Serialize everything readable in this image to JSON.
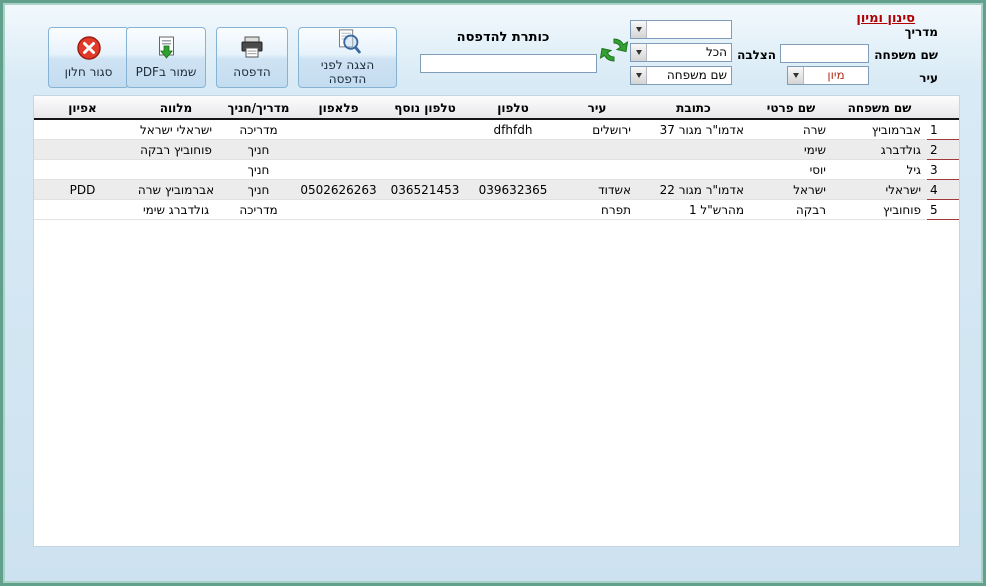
{
  "toolbar": {
    "close_label": "סגור חלון",
    "save_pdf_label": "שמור בPDF",
    "print_label": "הדפסה",
    "preview_label": "הצגה לפני הדפסה",
    "print_title_label": "כותרת להדפסה",
    "print_title_value": "",
    "icons": {
      "close": "red-circle-x",
      "save_pdf": "page-with-green-export-arrow",
      "print": "printer",
      "preview": "page-with-magnifier",
      "refresh": "green-circular-arrows"
    }
  },
  "filter_panel": {
    "title": "סינון ומיון",
    "instructor_label": "מדריך",
    "instructor_value": "",
    "crossing_label": "הצלבה",
    "crossing_value": "הכל",
    "last_name_label": "שם משפחה",
    "last_name_value": "",
    "city_label": "עיר",
    "sort_value": "מיון",
    "sort_by_value": "שם משפחה"
  },
  "colors": {
    "frame_teal": "#62a08e",
    "accent_red": "#b00000",
    "row_alt": "#ececec",
    "number_underline": "#a03a3a"
  },
  "table": {
    "headers": {
      "num": "",
      "last_name": "שם משפחה",
      "first_name": "שם פרטי",
      "address": "כתובת",
      "city": "עיר",
      "phone": "טלפון",
      "phone_extra": "טלפון נוסף",
      "mobile": "פלאפון",
      "role": "מדריך/חניך",
      "escort": "מלווה",
      "profile": "אפיון"
    },
    "rows": [
      {
        "num": "1",
        "last_name": "אברמוביץ",
        "first_name": "שרה",
        "address": "אדמו\"ר מגור 37",
        "city": "ירושלים",
        "phone": "dfhfdh",
        "phone_extra": "",
        "mobile": "",
        "role": "מדריכה",
        "escort": "ישראלי ישראל",
        "profile": ""
      },
      {
        "num": "2",
        "last_name": "גולדברג",
        "first_name": "שימי",
        "address": "",
        "city": "",
        "phone": "",
        "phone_extra": "",
        "mobile": "",
        "role": "חניך",
        "escort": "פוחוביץ רבקה",
        "profile": ""
      },
      {
        "num": "3",
        "last_name": "גיל",
        "first_name": "יוסי",
        "address": "",
        "city": "",
        "phone": "",
        "phone_extra": "",
        "mobile": "",
        "role": "חניך",
        "escort": "",
        "profile": ""
      },
      {
        "num": "4",
        "last_name": "ישראלי",
        "first_name": "ישראל",
        "address": "אדמו\"ר מגור 22",
        "city": "אשדוד",
        "phone": "039632365",
        "phone_extra": "036521453",
        "mobile": "0502626263",
        "role": "חניך",
        "escort": "אברמוביץ שרה",
        "profile": "PDD"
      },
      {
        "num": "5",
        "last_name": "פוחוביץ",
        "first_name": "רבקה",
        "address": "מהרש\"ל 1",
        "city": "תפרח",
        "phone": "",
        "phone_extra": "",
        "mobile": "",
        "role": "מדריכה",
        "escort": "גולדברג שימי",
        "profile": ""
      }
    ]
  }
}
